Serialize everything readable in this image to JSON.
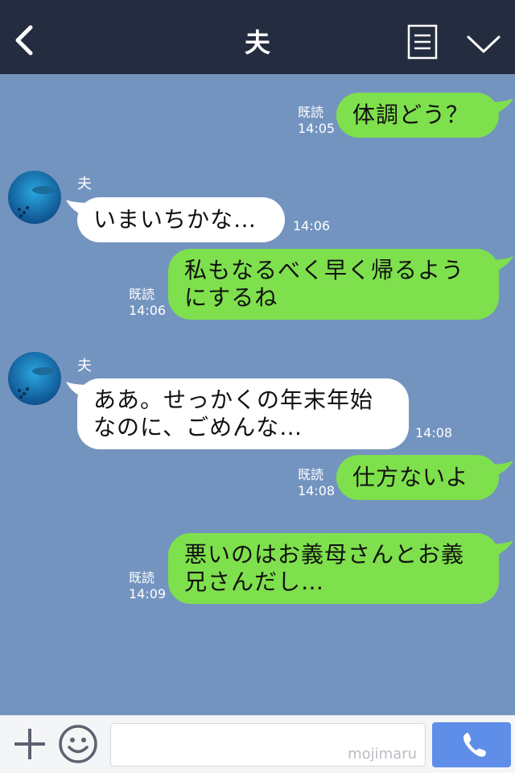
{
  "header": {
    "title": "夫"
  },
  "messages": [
    {
      "id": "m1",
      "direction": "out",
      "lines": [
        "体調どう？"
      ],
      "read": "既読",
      "time": "14:05"
    },
    {
      "id": "m2",
      "direction": "in",
      "sender": "夫",
      "lines": [
        "いまいちかな…"
      ],
      "time": "14:06"
    },
    {
      "id": "m3",
      "direction": "out",
      "lines": [
        "私もなるべく早く帰るよう",
        "にするね"
      ],
      "read": "既読",
      "time": "14:06"
    },
    {
      "id": "m4",
      "direction": "in",
      "sender": "夫",
      "lines": [
        "ああ。せっかくの年末年始",
        "なのに、ごめんな…"
      ],
      "time": "14:08"
    },
    {
      "id": "m5",
      "direction": "out",
      "lines": [
        "仕方ないよ"
      ],
      "read": "既読",
      "time": "14:08"
    },
    {
      "id": "m6",
      "direction": "out",
      "lines": [
        "悪いのはお義母さんとお義",
        "兄さんだし…"
      ],
      "read": "既読",
      "time": "14:09"
    }
  ],
  "footer": {
    "watermark": "mojimaru"
  },
  "colors": {
    "header_bg": "#242c3f",
    "chat_bg": "#7494c0",
    "outgoing_bubble": "#7ee04c",
    "incoming_bubble": "#ffffff",
    "call_button": "#5f8ee8"
  },
  "icons": [
    "back-arrow-icon",
    "notes-icon",
    "chevron-down-icon",
    "plus-icon",
    "emoji-icon",
    "phone-icon"
  ]
}
